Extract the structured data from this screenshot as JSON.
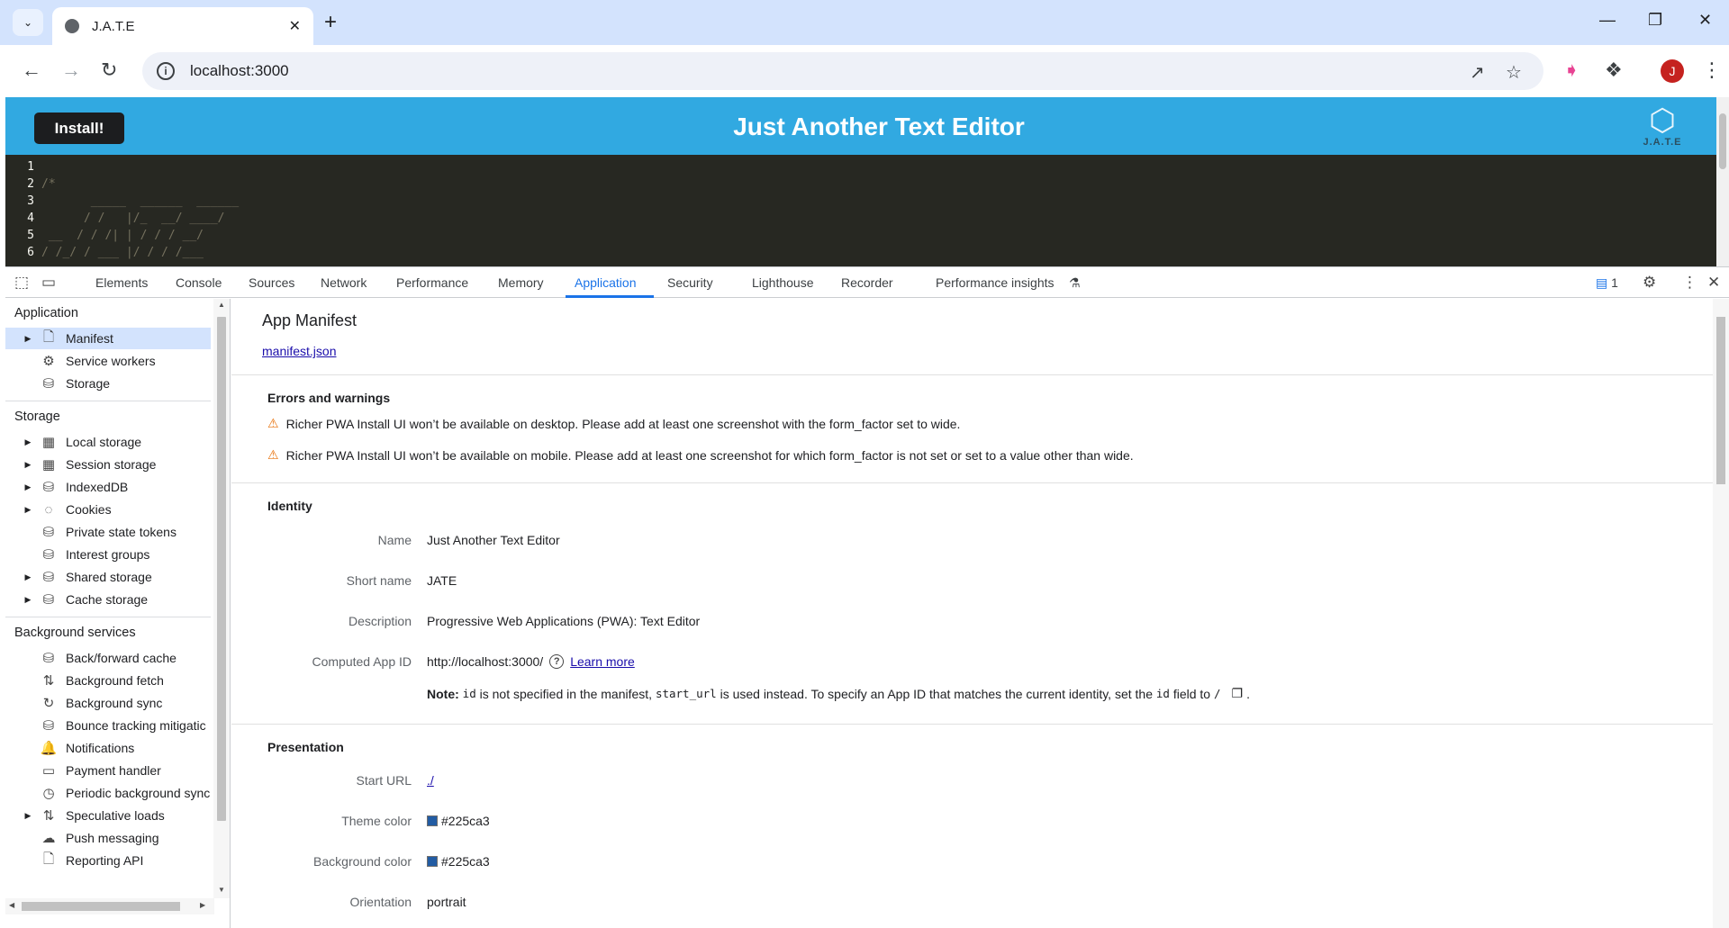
{
  "browser": {
    "tab_title": "J.A.T.E",
    "url": "localhost:3000",
    "profile_initial": "J"
  },
  "app": {
    "install_label": "Install!",
    "title": "Just Another Text Editor",
    "logo_text": "J.A.T.E",
    "code_lines": [
      {
        "n": "1",
        "text": ""
      },
      {
        "n": "2",
        "text": "/*"
      },
      {
        "n": "3",
        "text": "       _____  ______  ______"
      },
      {
        "n": "4",
        "text": "      / /   |/_  __/ ____/"
      },
      {
        "n": "5",
        "text": " __  / / /| | / / / __/"
      },
      {
        "n": "6",
        "text": "/ /_/ / ___ |/ / / /___"
      }
    ]
  },
  "devtools": {
    "tabs": [
      "Elements",
      "Console",
      "Sources",
      "Network",
      "Performance",
      "Memory",
      "Application",
      "Security",
      "Lighthouse",
      "Recorder",
      "Performance insights"
    ],
    "active_tab": "Application",
    "issues_count": "1",
    "sidebar": {
      "sections": [
        {
          "title": "Application",
          "items": [
            {
              "label": "Manifest",
              "icon": "file-icon",
              "expandable": true,
              "selected": true
            },
            {
              "label": "Service workers",
              "icon": "gears-icon",
              "expandable": false
            },
            {
              "label": "Storage",
              "icon": "database-icon",
              "expandable": false
            }
          ]
        },
        {
          "title": "Storage",
          "items": [
            {
              "label": "Local storage",
              "icon": "table-icon",
              "expandable": true
            },
            {
              "label": "Session storage",
              "icon": "table-icon",
              "expandable": true
            },
            {
              "label": "IndexedDB",
              "icon": "database-icon",
              "expandable": true
            },
            {
              "label": "Cookies",
              "icon": "cookie-icon",
              "expandable": true
            },
            {
              "label": "Private state tokens",
              "icon": "database-icon",
              "expandable": false
            },
            {
              "label": "Interest groups",
              "icon": "database-icon",
              "expandable": false
            },
            {
              "label": "Shared storage",
              "icon": "database-icon",
              "expandable": true
            },
            {
              "label": "Cache storage",
              "icon": "database-icon",
              "expandable": true
            }
          ]
        },
        {
          "title": "Background services",
          "items": [
            {
              "label": "Back/forward cache",
              "icon": "database-icon",
              "expandable": false
            },
            {
              "label": "Background fetch",
              "icon": "updown-icon",
              "expandable": false
            },
            {
              "label": "Background sync",
              "icon": "sync-icon",
              "expandable": false
            },
            {
              "label": "Bounce tracking mitigatic",
              "icon": "database-icon",
              "expandable": false
            },
            {
              "label": "Notifications",
              "icon": "bell-icon",
              "expandable": false
            },
            {
              "label": "Payment handler",
              "icon": "card-icon",
              "expandable": false
            },
            {
              "label": "Periodic background sync",
              "icon": "clock-icon",
              "expandable": false
            },
            {
              "label": "Speculative loads",
              "icon": "updown-icon",
              "expandable": true
            },
            {
              "label": "Push messaging",
              "icon": "cloud-icon",
              "expandable": false
            },
            {
              "label": "Reporting API",
              "icon": "file-icon",
              "expandable": false
            }
          ]
        }
      ]
    },
    "manifest": {
      "title": "App Manifest",
      "link": "manifest.json",
      "errors_heading": "Errors and warnings",
      "warnings": [
        "Richer PWA Install UI won’t be available on desktop. Please add at least one screenshot with the form_factor set to wide.",
        "Richer PWA Install UI won’t be available on mobile. Please add at least one screenshot for which form_factor is not set or set to a value other than wide."
      ],
      "identity_heading": "Identity",
      "identity": {
        "name_label": "Name",
        "name_value": "Just Another Text Editor",
        "short_label": "Short name",
        "short_value": "JATE",
        "desc_label": "Description",
        "desc_value": "Progressive Web Applications (PWA): Text Editor",
        "appid_label": "Computed App ID",
        "appid_value": "http://localhost:3000/",
        "learn_more": "Learn more",
        "note_bold": "Note:",
        "note_code1": "id",
        "note_text1": " is not specified in the manifest, ",
        "note_code2": "start_url",
        "note_text2": " is used instead. To specify an App ID that matches the current identity, set the ",
        "note_code3": "id",
        "note_text3": " field to ",
        "note_code4": "/",
        "note_end": "."
      },
      "presentation_heading": "Presentation",
      "presentation": {
        "start_label": "Start URL",
        "start_value": "./",
        "theme_label": "Theme color",
        "theme_value": "#225ca3",
        "bg_label": "Background color",
        "bg_value": "#225ca3",
        "orient_label": "Orientation",
        "orient_value": "portrait"
      }
    }
  },
  "colors": {
    "header_blue": "#31a9e1",
    "editor_bg": "#272822",
    "accent": "#1a73e8",
    "theme": "#225ca3"
  }
}
